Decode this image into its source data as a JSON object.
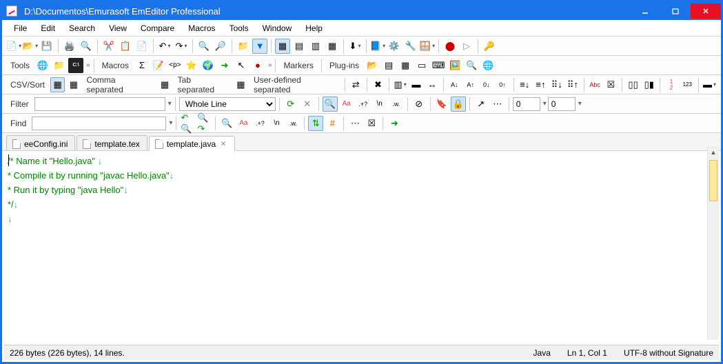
{
  "window": {
    "title": "D:\\Documentos\\Emurasoft EmEditor Professional"
  },
  "menubar": [
    "File",
    "Edit",
    "Search",
    "View",
    "Compare",
    "Macros",
    "Tools",
    "Window",
    "Help"
  ],
  "toolbar2": {
    "tools": "Tools",
    "macros": "Macros"
  },
  "csvbar": {
    "label": "CSV/Sort",
    "comma": "Comma separated",
    "tab": "Tab separated",
    "user": "User-defined separated"
  },
  "filterbar": {
    "label": "Filter",
    "scope": "Whole Line",
    "num1": "0",
    "num2": "0"
  },
  "findbar": {
    "label": "Find"
  },
  "toolbar3": {
    "markers": "Markers",
    "plugins": "Plug-ins"
  },
  "tabs": [
    {
      "name": "eeConfig.ini",
      "active": false
    },
    {
      "name": "template.tex",
      "active": false
    },
    {
      "name": "template.java",
      "active": true
    }
  ],
  "editor": {
    "lines": [
      "/* Name it \"Hello.java\" ",
      " * Compile it by running \"javac Hello.java\"",
      " * Run it by typing \"java Hello\"",
      " */",
      ""
    ]
  },
  "status": {
    "left": "226 bytes (226 bytes), 14 lines.",
    "lang": "Java",
    "pos": "Ln 1, Col 1",
    "enc": "UTF-8 without Signature"
  }
}
